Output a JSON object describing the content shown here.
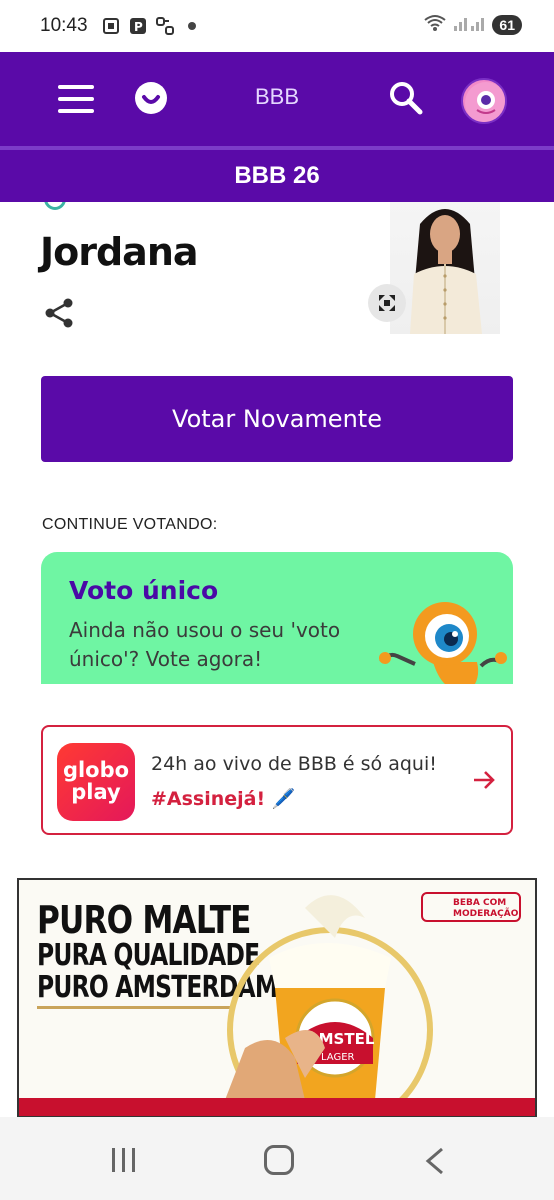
{
  "status_bar": {
    "time": "10:43",
    "battery": "61"
  },
  "header": {
    "title": "BBB",
    "section": "BBB 26"
  },
  "participant": {
    "name": "Jordana"
  },
  "vote_button_label": "Votar Novamente",
  "continue_label": "CONTINUE VOTANDO:",
  "voto_card": {
    "title": "Voto único",
    "description": "Ainda não usou o seu 'voto único'? Vote agora!"
  },
  "globoplay_card": {
    "logo_line1": "globo",
    "logo_line2": "play",
    "text": "24h ao vivo de BBB é só aqui!",
    "cta": "#Assinejá! 🖊️"
  },
  "ad": {
    "line1": "PURO MALTE",
    "line2": "PURA QUALIDADE",
    "line3": "PURO AMSTERDAM",
    "badge": "BEBA COM MODERAÇÃO",
    "brand": "AMSTEL",
    "brand_sub": "LAGER"
  },
  "colors": {
    "primary": "#5a0aa8",
    "voto_bg": "#6ff5a3",
    "globo_red": "#d4213f"
  }
}
